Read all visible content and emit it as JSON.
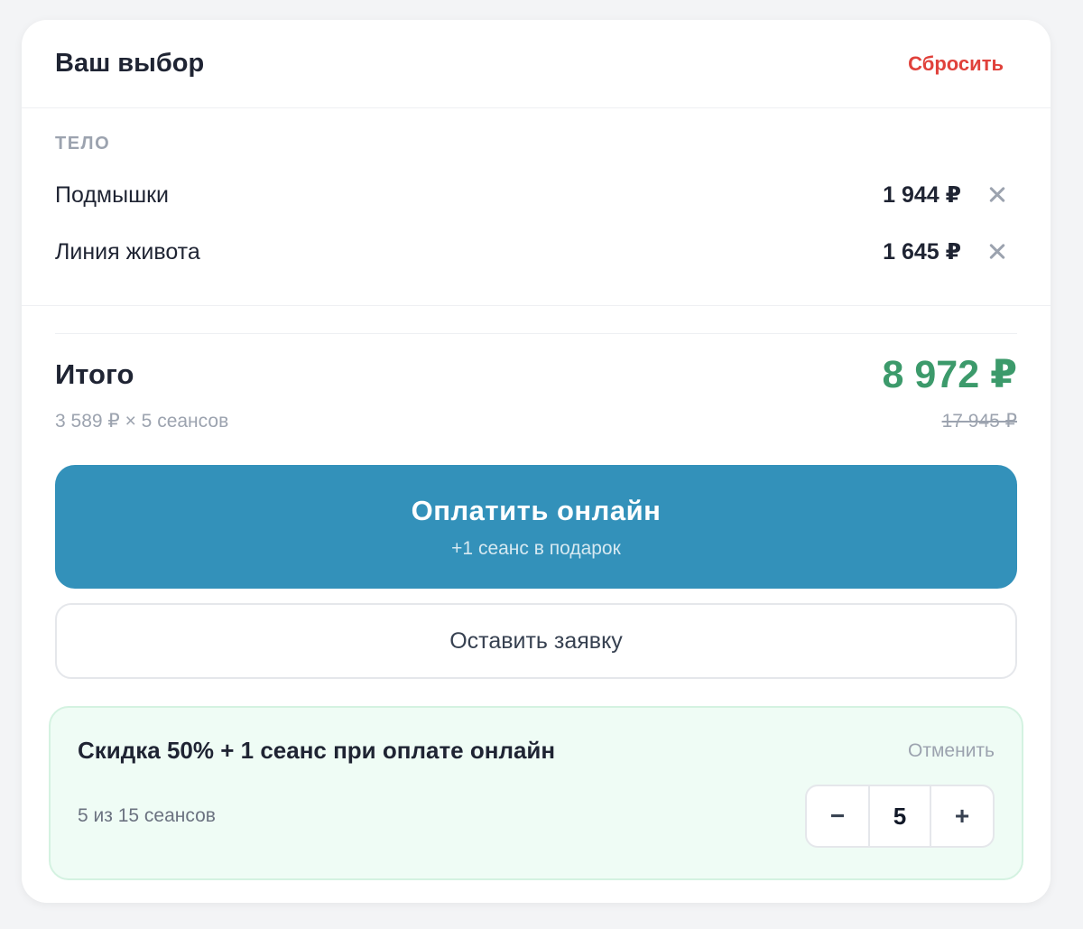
{
  "header": {
    "title": "Ваш выбор",
    "reset_label": "Сбросить"
  },
  "selection": {
    "category": "ТЕЛО",
    "items": [
      {
        "name": "Подмышки",
        "price": "1 944 ₽"
      },
      {
        "name": "Линия живота",
        "price": "1 645 ₽"
      }
    ]
  },
  "totals": {
    "label": "Итого",
    "price": "8 972 ₽",
    "per_session": "3 589 ₽ × 5 сеансов",
    "old_price": "17 945 ₽"
  },
  "pay_button": {
    "label": "Оплатить онлайн",
    "sub": "+1 сеанс в подарок"
  },
  "request_button": {
    "label": "Оставить заявку"
  },
  "promo": {
    "title": "Скидка 50% + 1 сеанс при оплате онлайн",
    "cancel_label": "Отменить",
    "count_text": "5 из 15 сеансов",
    "stepper": {
      "minus": "−",
      "value": "5",
      "plus": "+"
    }
  },
  "colors": {
    "accent": "#3391ba",
    "price_green": "#3c9a6b",
    "reset_red": "#e0413b",
    "promo_bg": "#effcf5"
  },
  "icons": {
    "remove": "close-icon"
  }
}
